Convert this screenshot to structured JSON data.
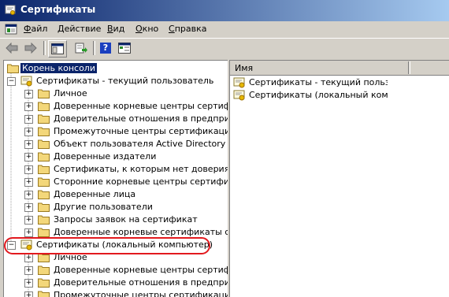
{
  "window": {
    "title": "Сертификаты"
  },
  "menu": [
    {
      "label": "Файл",
      "underline": "Ф",
      "rest": "айл"
    },
    {
      "label": "Действие",
      "underline": "Д",
      "rest": "ействие"
    },
    {
      "label": "Вид",
      "underline": "В",
      "rest": "ид"
    },
    {
      "label": "Окно",
      "underline": "О",
      "rest": "кно"
    },
    {
      "label": "Справка",
      "underline": "С",
      "rest": "правка"
    }
  ],
  "toolbar": {
    "back": "back-arrow-icon",
    "forward": "forward-arrow-icon",
    "show_tree": "console-tree-icon",
    "export": "export-list-icon",
    "help": "?",
    "properties": "properties-icon"
  },
  "tree": {
    "root": "Корень консоли",
    "user": {
      "label": "Сертификаты - текущий пользователь",
      "children": [
        "Личное",
        "Доверенные корневые центры сертификации",
        "Доверительные отношения в предприятии",
        "Промежуточные центры сертификации",
        "Объект пользователя Active Directory",
        "Доверенные издатели",
        "Сертификаты, к которым нет доверия",
        "Сторонние корневые центры сертификации",
        "Доверенные лица",
        "Другие пользователи",
        "Запросы заявок на сертификат",
        "Доверенные корневые сертификаты смарт-карты"
      ]
    },
    "computer": {
      "label": "Сертификаты (локальный компьютер)",
      "children": [
        "Личное",
        "Доверенные корневые центры сертификации",
        "Доверительные отношения в предприятии",
        "Промежуточные центры сертификации"
      ]
    }
  },
  "list": {
    "column_name": "Имя",
    "items": [
      "Сертификаты - текущий пользователь",
      "Сертификаты (локальный компьютер)"
    ]
  },
  "colors": {
    "highlight": "#e2191e",
    "selection": "#0a246a"
  }
}
